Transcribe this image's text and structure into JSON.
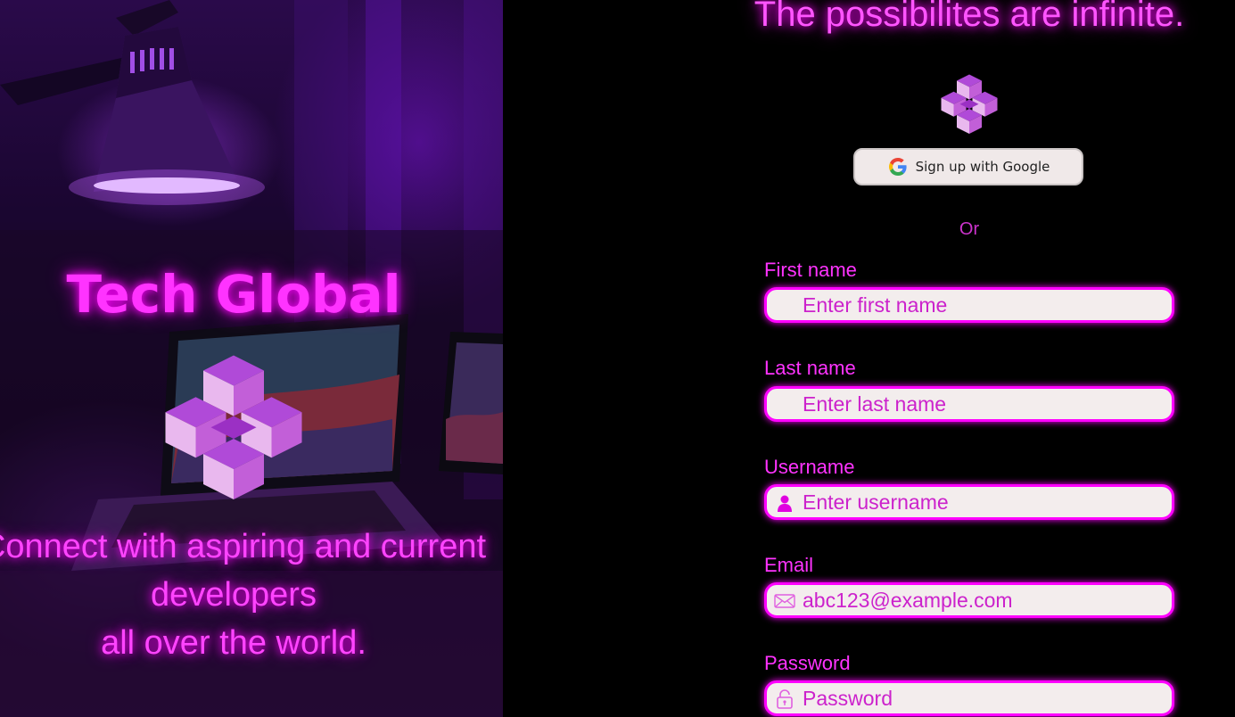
{
  "hero": {
    "title": "Tech Global",
    "tagline_line1": "Connect with aspiring and current",
    "tagline_line2": "developers",
    "tagline_line3": "all over the world."
  },
  "form": {
    "heading": "The possibilites are infinite.",
    "google_button_label": "Sign up with Google",
    "or_text": "Or",
    "fields": {
      "first_name": {
        "label": "First name",
        "placeholder": "Enter first name",
        "icon": "none"
      },
      "last_name": {
        "label": "Last name",
        "placeholder": "Enter last name",
        "icon": "none"
      },
      "username": {
        "label": "Username",
        "placeholder": "Enter username",
        "icon": "user-icon"
      },
      "email": {
        "label": "Email",
        "placeholder": "abc123@example.com",
        "icon": "envelope-icon"
      },
      "password": {
        "label": "Password",
        "placeholder": "Password",
        "icon": "lock-icon"
      }
    }
  },
  "colors": {
    "accent": "#ff00ff",
    "text_neon": "#ff33ff",
    "background": "#000000",
    "input_bg": "#f3eded",
    "google_btn_bg": "#f0e9e9"
  }
}
